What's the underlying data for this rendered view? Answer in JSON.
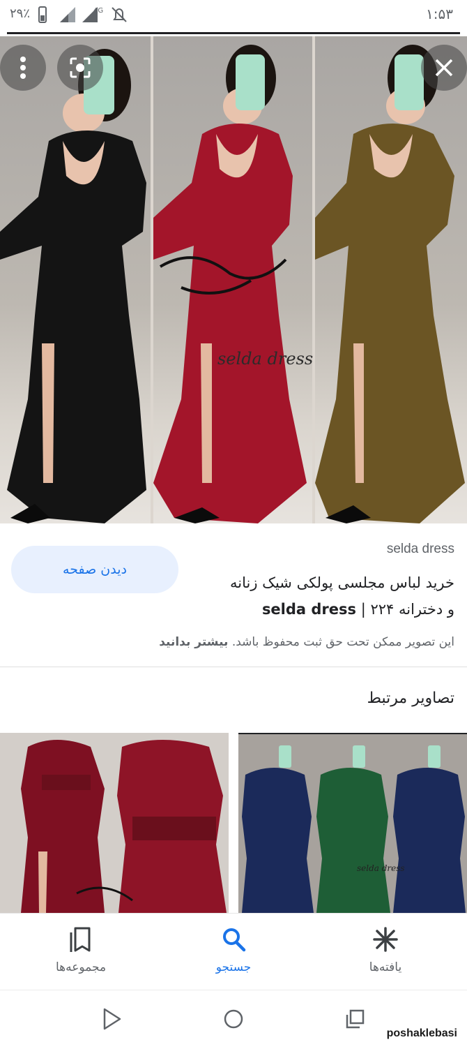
{
  "status_bar": {
    "time": "۱:۵۳",
    "battery_percent": "۲۹٪",
    "network_label": "4G"
  },
  "hero": {
    "watermark": "selda dress",
    "dress_colors": [
      "#141414",
      "#a3152a",
      "#6b5524"
    ]
  },
  "result": {
    "source": "selda dress",
    "title_line1": "خرید لباس مجلسی پولکی شیک زنانه",
    "title_line2_prefix": "و دخترانه ۲۲۴ | ",
    "title_line2_bold": "selda dress",
    "visit_button": "دیدن صفحه",
    "copyright_text": "این تصویر ممکن تحت حق ثبت محفوظ باشد. ",
    "learn_more": "بیشتر بدانید"
  },
  "related": {
    "title": "تصاویر مرتبط",
    "thumb_watermark": "selda dress"
  },
  "bottom_nav": {
    "items": [
      {
        "label": "مجموعه‌ها",
        "icon": "collections-icon"
      },
      {
        "label": "جستجو",
        "icon": "search-icon"
      },
      {
        "label": "یافته‌ها",
        "icon": "discover-icon"
      }
    ],
    "active": "جستجو"
  },
  "site_watermark": "poshaklebasi",
  "colors": {
    "accent": "#1a73e8",
    "button_bg": "#e8f0fe",
    "text_secondary": "#5f6368"
  }
}
